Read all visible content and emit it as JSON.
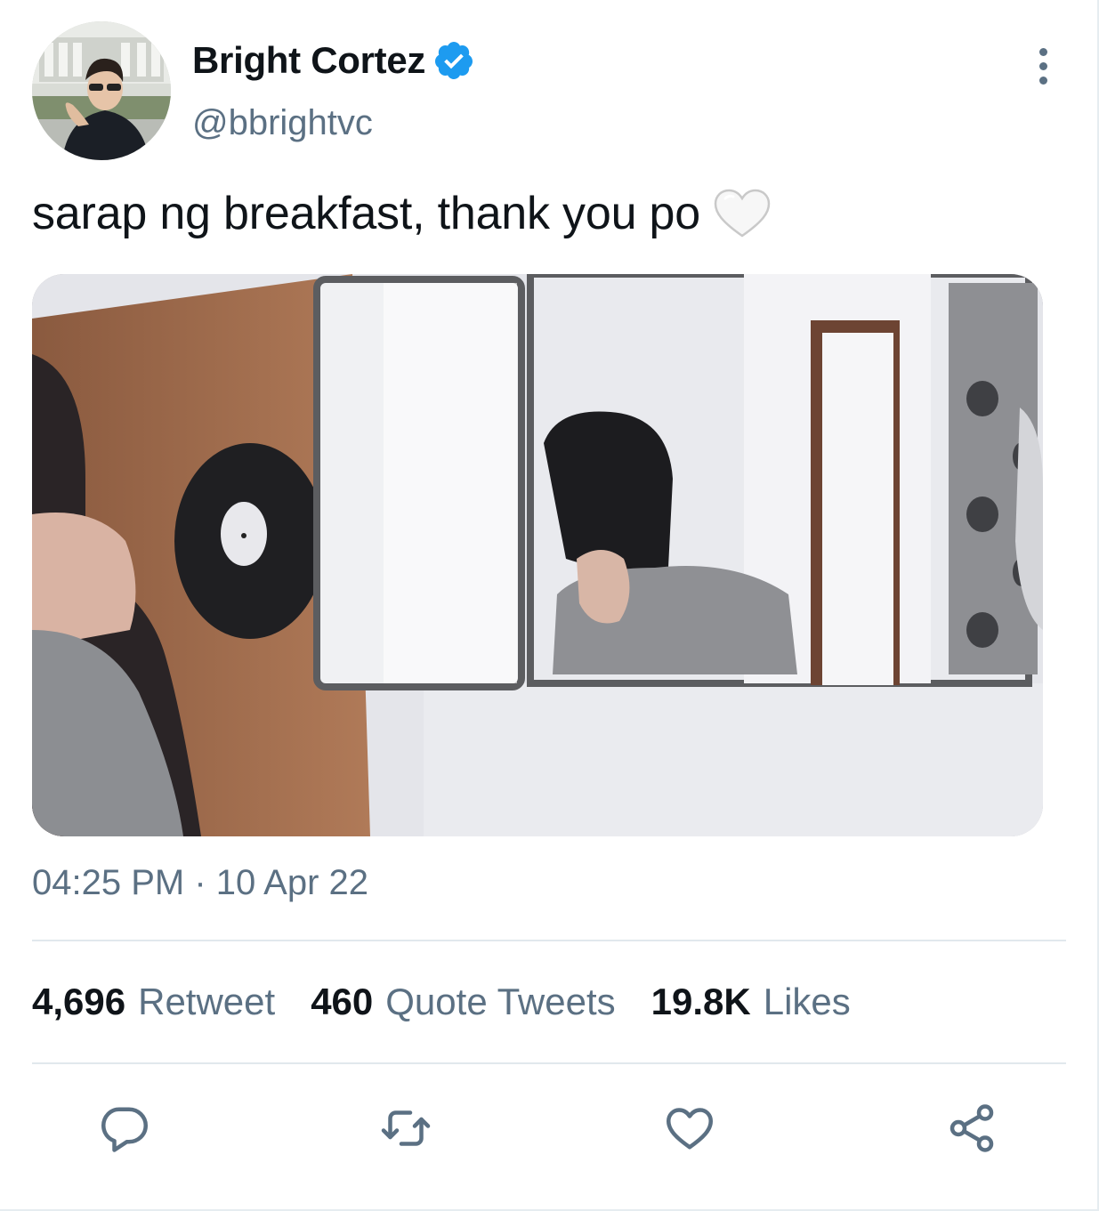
{
  "tweet": {
    "author": {
      "display_name": "Bright Cortez",
      "handle": "@bbrightvc",
      "verified": true
    },
    "text": "sarap ng breakfast, thank you po",
    "emoji": "white-heart-emoji",
    "timestamp": "04:25 PM · 10 Apr 22",
    "stats": {
      "retweets": {
        "count": "4,696",
        "label": "Retweet"
      },
      "quotes": {
        "count": "460",
        "label": "Quote Tweets"
      },
      "likes": {
        "count": "19.8K",
        "label": "Likes"
      }
    },
    "actions": [
      "reply-icon",
      "retweet-icon",
      "like-icon",
      "share-icon"
    ],
    "colors": {
      "primary_text": "#0f1419",
      "secondary_text": "#5b7083",
      "verified_blue": "#1d9bf0",
      "divider": "#e1e8ed"
    }
  }
}
